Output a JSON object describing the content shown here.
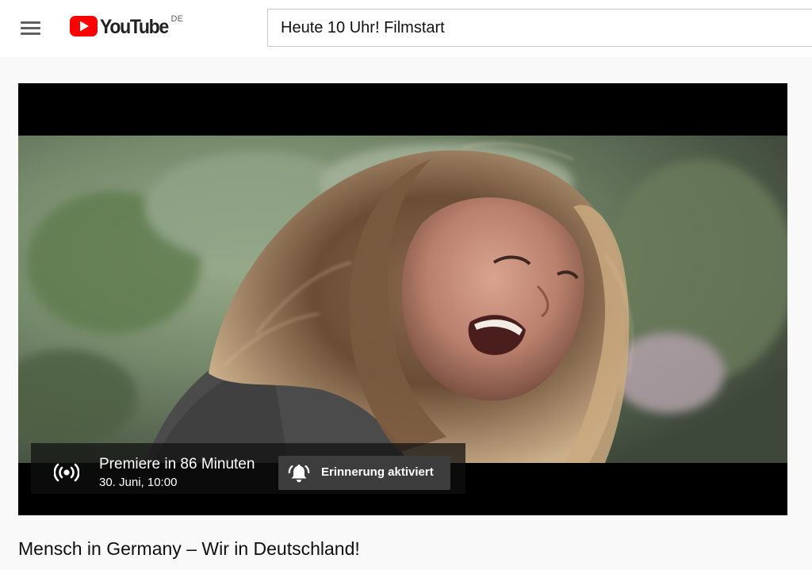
{
  "header": {
    "logo_text": "YouTube",
    "country_code": "DE",
    "search_value": "Heute 10 Uhr! Filmstart"
  },
  "player": {
    "premiere_text": "Premiere in 86 Minuten",
    "premiere_date": "30. Juni, 10:00",
    "reminder_label": "Erinnerung aktiviert"
  },
  "video": {
    "title": "Mensch in Germany – Wir in Deutschland!"
  },
  "colors": {
    "logo_red": "#ff0000",
    "icon_gray": "#606060",
    "page_bg": "#f9f9f9"
  },
  "icons": [
    "menu-icon",
    "youtube-play-icon",
    "live-broadcast-icon",
    "bell-icon"
  ]
}
